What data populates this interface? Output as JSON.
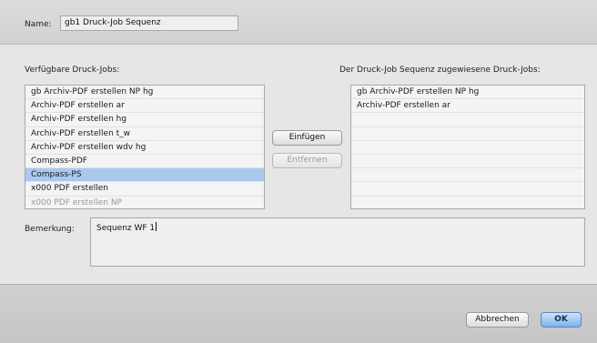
{
  "header": {
    "name_label": "Name:",
    "name_value": "gb1  Druck-Job Sequenz"
  },
  "available": {
    "label": "Verfügbare Druck-Jobs:",
    "items": [
      "gb Archiv-PDF erstellen NP hg",
      "Archiv-PDF erstellen ar",
      "Archiv-PDF erstellen hg",
      "Archiv-PDF erstellen t_w",
      "Archiv-PDF erstellen wdv hg",
      "Compass-PDF",
      "Compass-PS",
      "x000 PDF erstellen",
      "x000 PDF erstellen NP"
    ],
    "selected_index": 6
  },
  "assigned": {
    "label": "Der Druck-Job Sequenz zugewiesene Druck-Jobs:",
    "items": [
      "gb Archiv-PDF erstellen NP hg",
      "Archiv-PDF erstellen ar"
    ]
  },
  "buttons": {
    "insert": "Einfügen",
    "remove": "Entfernen",
    "cancel": "Abbrechen",
    "ok": "OK"
  },
  "remark": {
    "label": "Bemerkung:",
    "value": "Sequenz WF 1"
  }
}
